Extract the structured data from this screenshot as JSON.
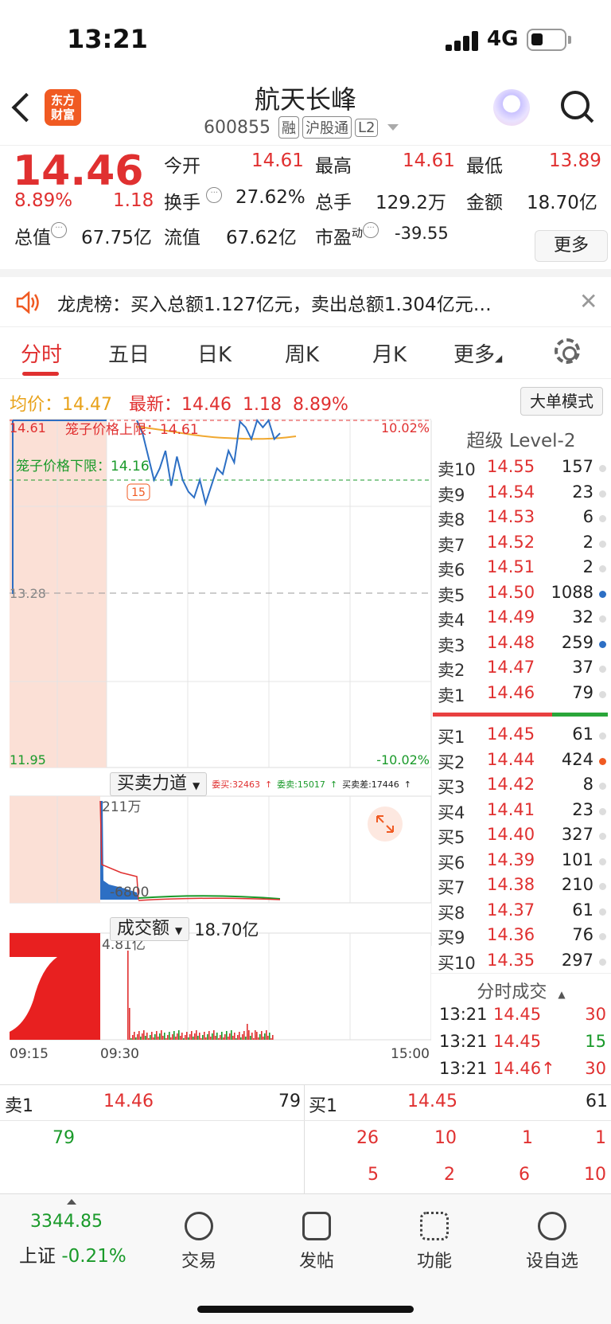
{
  "status": {
    "time": "13:21",
    "network": "4G"
  },
  "header": {
    "logo": "东方\n财富",
    "name": "航天长峰",
    "code": "600855",
    "tags": [
      "融",
      "沪股通",
      "L2"
    ]
  },
  "quote": {
    "price": "14.46",
    "change_pct": "8.89%",
    "change": "1.18",
    "open_label": "今开",
    "open": "14.61",
    "high_label": "最高",
    "high": "14.61",
    "low_label": "最低",
    "low": "13.89",
    "turnover_label": "换手",
    "turnover": "27.62%",
    "volume_label": "总手",
    "volume": "129.2万",
    "amount_label": "金额",
    "amount": "18.70亿",
    "mktcap_label": "总值",
    "mktcap": "67.75亿",
    "float_label": "流值",
    "float": "67.62亿",
    "pe_label": "市盈",
    "pe_sup": "动",
    "pe": "-39.55",
    "more": "更多"
  },
  "notice": {
    "text": "龙虎榜：买入总额1.127亿元，卖出总额1.304亿元…"
  },
  "tabs": [
    "分时",
    "五日",
    "日K",
    "周K",
    "月K",
    "更多"
  ],
  "avg_line": {
    "avg_label": "均价：",
    "avg": "14.47",
    "latest_label": "最新：",
    "latest": "14.46",
    "change": "1.18",
    "pct": "8.89%"
  },
  "mode_button": "大单模式",
  "chart_data": {
    "type": "line",
    "price_axis": {
      "top": "14.61",
      "mid": "13.28",
      "bottom": "11.95",
      "top_pct": "10.02%",
      "bottom_pct": "-10.02%"
    },
    "cage_upper_label": "笼子价格上限：14.61",
    "cage_lower_label": "笼子价格下限：14.16",
    "badge": "15",
    "x_ticks": [
      "09:15",
      "09:30",
      "15:00"
    ],
    "indicator1": {
      "name": "买卖力道",
      "wt_buy": "委买:32463",
      "wt_sell": "委卖:15017",
      "diff": "买卖差:17446",
      "max": "211万",
      "min": "-6800"
    },
    "indicator2": {
      "name": "成交额",
      "total": "18.70亿",
      "max": "4.81亿"
    },
    "price_series": [
      14.61,
      14.5,
      14.3,
      14.1,
      14.2,
      14.35,
      14.05,
      14.3,
      14.1,
      14.0,
      13.95,
      14.1,
      13.9,
      14.05,
      14.2,
      14.15,
      14.35,
      14.25,
      14.6,
      14.55,
      14.45,
      14.61,
      14.55,
      14.61,
      14.45,
      14.5
    ]
  },
  "order_book": {
    "title": "超级 Level-2",
    "sell": [
      {
        "label": "卖10",
        "price": "14.55",
        "vol": "157"
      },
      {
        "label": "卖9",
        "price": "14.54",
        "vol": "23"
      },
      {
        "label": "卖8",
        "price": "14.53",
        "vol": "6"
      },
      {
        "label": "卖7",
        "price": "14.52",
        "vol": "2"
      },
      {
        "label": "卖6",
        "price": "14.51",
        "vol": "2"
      },
      {
        "label": "卖5",
        "price": "14.50",
        "vol": "1088"
      },
      {
        "label": "卖4",
        "price": "14.49",
        "vol": "32"
      },
      {
        "label": "卖3",
        "price": "14.48",
        "vol": "259"
      },
      {
        "label": "卖2",
        "price": "14.47",
        "vol": "37"
      },
      {
        "label": "卖1",
        "price": "14.46",
        "vol": "79"
      }
    ],
    "buy": [
      {
        "label": "买1",
        "price": "14.45",
        "vol": "61"
      },
      {
        "label": "买2",
        "price": "14.44",
        "vol": "424"
      },
      {
        "label": "买3",
        "price": "14.42",
        "vol": "8"
      },
      {
        "label": "买4",
        "price": "14.41",
        "vol": "23"
      },
      {
        "label": "买5",
        "price": "14.40",
        "vol": "327"
      },
      {
        "label": "买6",
        "price": "14.39",
        "vol": "101"
      },
      {
        "label": "买7",
        "price": "14.38",
        "vol": "210"
      },
      {
        "label": "买8",
        "price": "14.37",
        "vol": "61"
      },
      {
        "label": "买9",
        "price": "14.36",
        "vol": "76"
      },
      {
        "label": "买10",
        "price": "14.35",
        "vol": "297"
      }
    ]
  },
  "ticks": {
    "title": "分时成交",
    "rows": [
      {
        "time": "13:21",
        "price": "14.45",
        "vol": "30"
      },
      {
        "time": "13:21",
        "price": "14.45",
        "vol": "15"
      },
      {
        "time": "13:21",
        "price": "14.46↑",
        "vol": "30"
      }
    ]
  },
  "bottom_book": {
    "sell_label": "卖1",
    "sell_price": "14.46",
    "sell_vol": "79",
    "sell_queue": [
      "79"
    ],
    "buy_label": "买1",
    "buy_price": "14.45",
    "buy_vol": "61",
    "buy_queue": [
      "26",
      "10",
      "1",
      "1",
      "5",
      "2",
      "6",
      "10"
    ]
  },
  "tabbar": {
    "index_value": "3344.85",
    "index_name": "上证",
    "index_pct": "-0.21%",
    "items": [
      "交易",
      "发帖",
      "功能",
      "设自选"
    ]
  }
}
